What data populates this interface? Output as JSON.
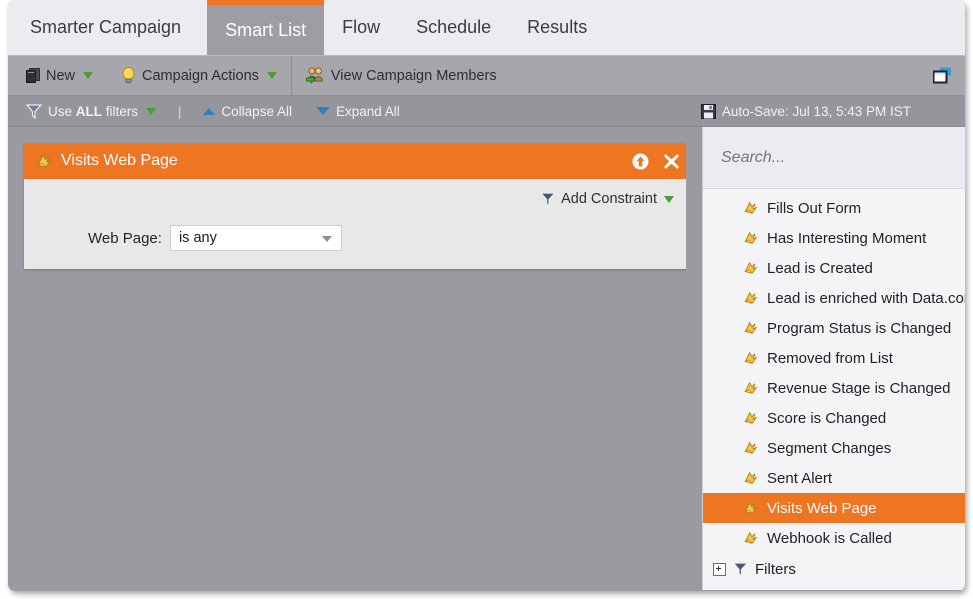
{
  "tabs": [
    {
      "label": "Smarter Campaign",
      "active": false
    },
    {
      "label": "Smart List",
      "active": true
    },
    {
      "label": "Flow",
      "active": false
    },
    {
      "label": "Schedule",
      "active": false
    },
    {
      "label": "Results",
      "active": false
    }
  ],
  "toolbar": {
    "new_label": "New",
    "campaign_actions_label": "Campaign Actions",
    "view_members_label": "View Campaign Members",
    "window_icon": "window-restore-icon"
  },
  "filterbar": {
    "use_filters_prefix": "Use ",
    "use_filters_strong": "ALL",
    "use_filters_suffix": " filters",
    "separator": "|",
    "collapse_all_label": "Collapse All",
    "expand_all_label": "Expand All",
    "autosave_label": "Auto-Save: Jul 13, 5:43 PM IST",
    "save_icon": "floppy-disk-icon"
  },
  "rule_panel": {
    "title": "Visits Web Page",
    "trigger_icon": "lightning-flag-icon",
    "move_up_icon": "arrow-up-circle-icon",
    "close_icon": "close-x-icon",
    "add_constraint_label": "Add Constraint",
    "field_label": "Web Page:",
    "field_value": "is any",
    "field_placeholder": "is any"
  },
  "sidebar": {
    "search_placeholder": "Search...",
    "search_value": "",
    "items": [
      {
        "label": "Fills Out Form",
        "selected": false
      },
      {
        "label": "Has Interesting Moment",
        "selected": false
      },
      {
        "label": "Lead is Created",
        "selected": false
      },
      {
        "label": "Lead is enriched with Data.com",
        "selected": false
      },
      {
        "label": "Program Status is Changed",
        "selected": false
      },
      {
        "label": "Removed from List",
        "selected": false
      },
      {
        "label": "Revenue Stage is Changed",
        "selected": false
      },
      {
        "label": "Score is Changed",
        "selected": false
      },
      {
        "label": "Segment Changes",
        "selected": false
      },
      {
        "label": "Sent Alert",
        "selected": false
      },
      {
        "label": "Visits Web Page",
        "selected": true
      },
      {
        "label": "Webhook is Called",
        "selected": false
      }
    ],
    "filters_node_label": "Filters"
  },
  "colors": {
    "accent_orange": "#ee7623",
    "tab_active_bg": "#9d9da3",
    "toolbar_bg": "#a6a6ac",
    "filterbar_bg": "#95959c",
    "canvas_bg": "#9a9aa0",
    "panel_bg": "#e8e8e8",
    "sidebar_bg": "#f4f4f6"
  }
}
